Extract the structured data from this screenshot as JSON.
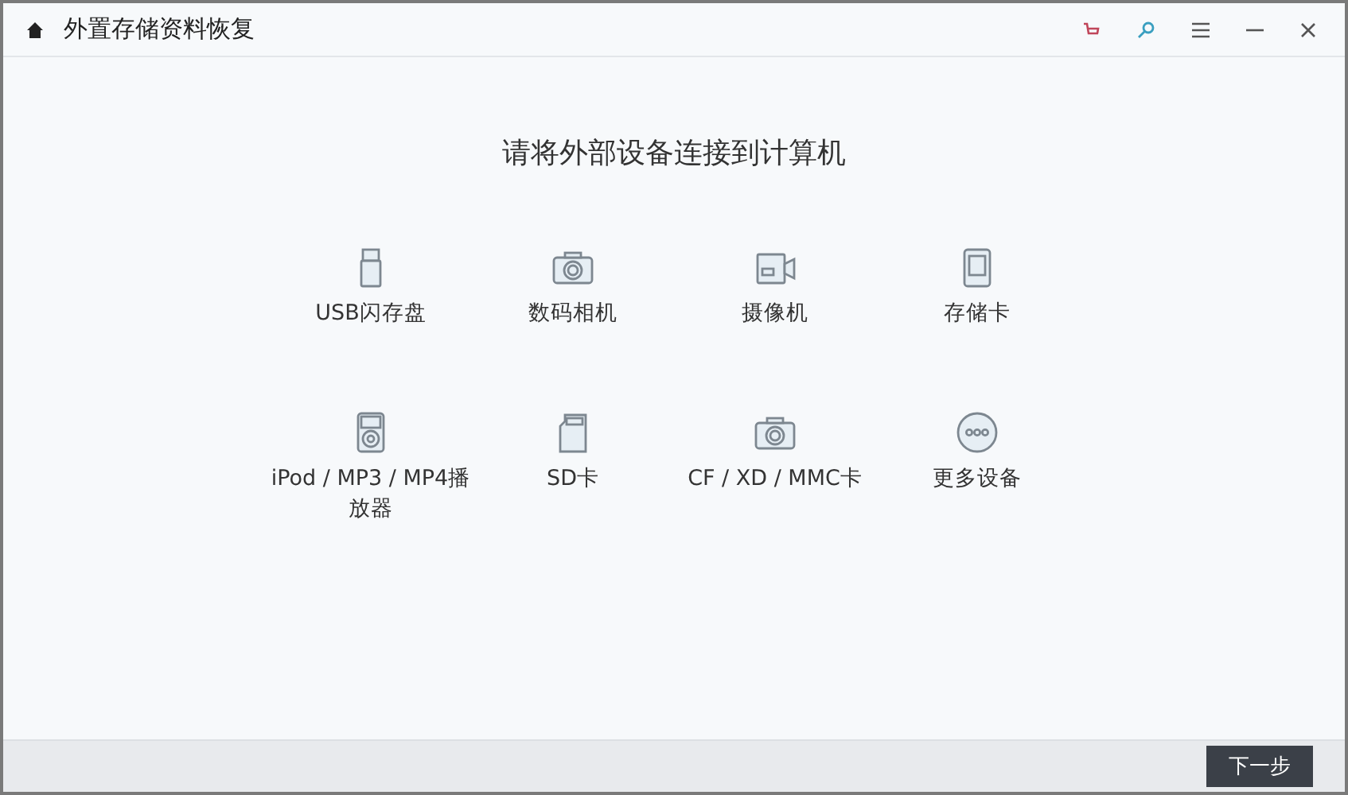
{
  "window": {
    "title": "外置存储资料恢复"
  },
  "heading": "请将外部设备连接到计算机",
  "devices": [
    {
      "kind": "usb",
      "label": "USB闪存盘"
    },
    {
      "kind": "camera",
      "label": "数码相机"
    },
    {
      "kind": "camcorder",
      "label": "摄像机"
    },
    {
      "kind": "card",
      "label": "存储卡"
    },
    {
      "kind": "player",
      "label": "iPod / MP3 / MP4播放器"
    },
    {
      "kind": "sd",
      "label": "SD卡"
    },
    {
      "kind": "camera",
      "label": "CF / XD / MMC卡"
    },
    {
      "kind": "more",
      "label": "更多设备"
    }
  ],
  "footer": {
    "next_button": "下一步"
  }
}
